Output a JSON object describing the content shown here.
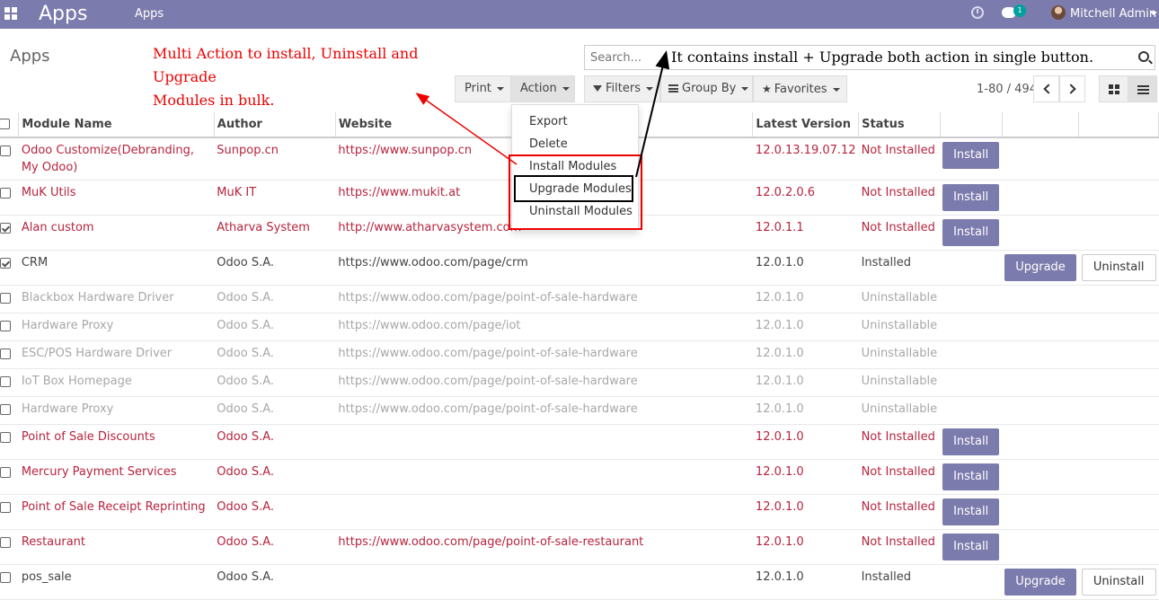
{
  "topbar": {
    "brand": "Apps",
    "menu_apps": "Apps",
    "chat_count": "1",
    "user_name": "Mitchell Admin"
  },
  "control_panel": {
    "title": "Apps",
    "search_placeholder": "Search...",
    "print": "Print",
    "action": "Action",
    "filters": "Filters",
    "group_by": "Group By",
    "favorites": "Favorites",
    "pager": "1-80 / 494"
  },
  "annotations": {
    "red_note_line1": "Multi Action to install, Uninstall and Upgrade",
    "red_note_line2": "Modules in bulk.",
    "black_note": "It contains install + Upgrade both action in single button."
  },
  "action_menu": {
    "items": [
      "Export",
      "Delete",
      "Install Modules",
      "Upgrade Modules",
      "Uninstall Modules"
    ]
  },
  "table": {
    "headers": [
      "Module Name",
      "Author",
      "Website",
      "Latest Version",
      "Status"
    ],
    "rows": [
      {
        "name": "Odoo Customize(Debranding, My Odoo)",
        "author": "Sunpop.cn",
        "website": "https://www.sunpop.cn",
        "version": "12.0.13.19.07.12",
        "status": "Not Installed",
        "action": "Install",
        "checked": false,
        "style": "red"
      },
      {
        "name": "MuK Utils",
        "author": "MuK IT",
        "website": "https://www.mukit.at",
        "version": "12.0.2.0.6",
        "status": "Not Installed",
        "action": "Install",
        "checked": false,
        "style": "red"
      },
      {
        "name": "Alan custom",
        "author": "Atharva System",
        "website": "http://www.atharvasystem.com",
        "version": "12.0.1.1",
        "status": "Not Installed",
        "action": "Install",
        "checked": true,
        "style": "red"
      },
      {
        "name": "CRM",
        "author": "Odoo S.A.",
        "website": "https://www.odoo.com/page/crm",
        "version": "12.0.1.0",
        "status": "Installed",
        "action": "Upgrade",
        "action2": "Uninstall",
        "checked": true,
        "style": "dark"
      },
      {
        "name": "Blackbox Hardware Driver",
        "author": "Odoo S.A.",
        "website": "https://www.odoo.com/page/point-of-sale-hardware",
        "version": "12.0.1.0",
        "status": "Uninstallable",
        "checked": false,
        "style": "gray"
      },
      {
        "name": "Hardware Proxy",
        "author": "Odoo S.A.",
        "website": "https://www.odoo.com/page/iot",
        "version": "12.0.1.0",
        "status": "Uninstallable",
        "checked": false,
        "style": "gray"
      },
      {
        "name": "ESC/POS Hardware Driver",
        "author": "Odoo S.A.",
        "website": "https://www.odoo.com/page/point-of-sale-hardware",
        "version": "12.0.1.0",
        "status": "Uninstallable",
        "checked": false,
        "style": "gray"
      },
      {
        "name": "IoT Box Homepage",
        "author": "Odoo S.A.",
        "website": "https://www.odoo.com/page/point-of-sale-hardware",
        "version": "12.0.1.0",
        "status": "Uninstallable",
        "checked": false,
        "style": "gray"
      },
      {
        "name": "Hardware Proxy",
        "author": "Odoo S.A.",
        "website": "https://www.odoo.com/page/point-of-sale-hardware",
        "version": "12.0.1.0",
        "status": "Uninstallable",
        "checked": false,
        "style": "gray"
      },
      {
        "name": "Point of Sale Discounts",
        "author": "Odoo S.A.",
        "website": "",
        "version": "12.0.1.0",
        "status": "Not Installed",
        "action": "Install",
        "checked": false,
        "style": "red"
      },
      {
        "name": "Mercury Payment Services",
        "author": "Odoo S.A.",
        "website": "",
        "version": "12.0.1.0",
        "status": "Not Installed",
        "action": "Install",
        "checked": false,
        "style": "red"
      },
      {
        "name": "Point of Sale Receipt Reprinting",
        "author": "Odoo S.A.",
        "website": "",
        "version": "12.0.1.0",
        "status": "Not Installed",
        "action": "Install",
        "checked": false,
        "style": "red"
      },
      {
        "name": "Restaurant",
        "author": "Odoo S.A.",
        "website": "https://www.odoo.com/page/point-of-sale-restaurant",
        "version": "12.0.1.0",
        "status": "Not Installed",
        "action": "Install",
        "checked": false,
        "style": "red"
      },
      {
        "name": "pos_sale",
        "author": "Odoo S.A.",
        "website": "",
        "version": "12.0.1.0",
        "status": "Installed",
        "action": "Upgrade",
        "action2": "Uninstall",
        "checked": false,
        "style": "dark"
      }
    ]
  }
}
